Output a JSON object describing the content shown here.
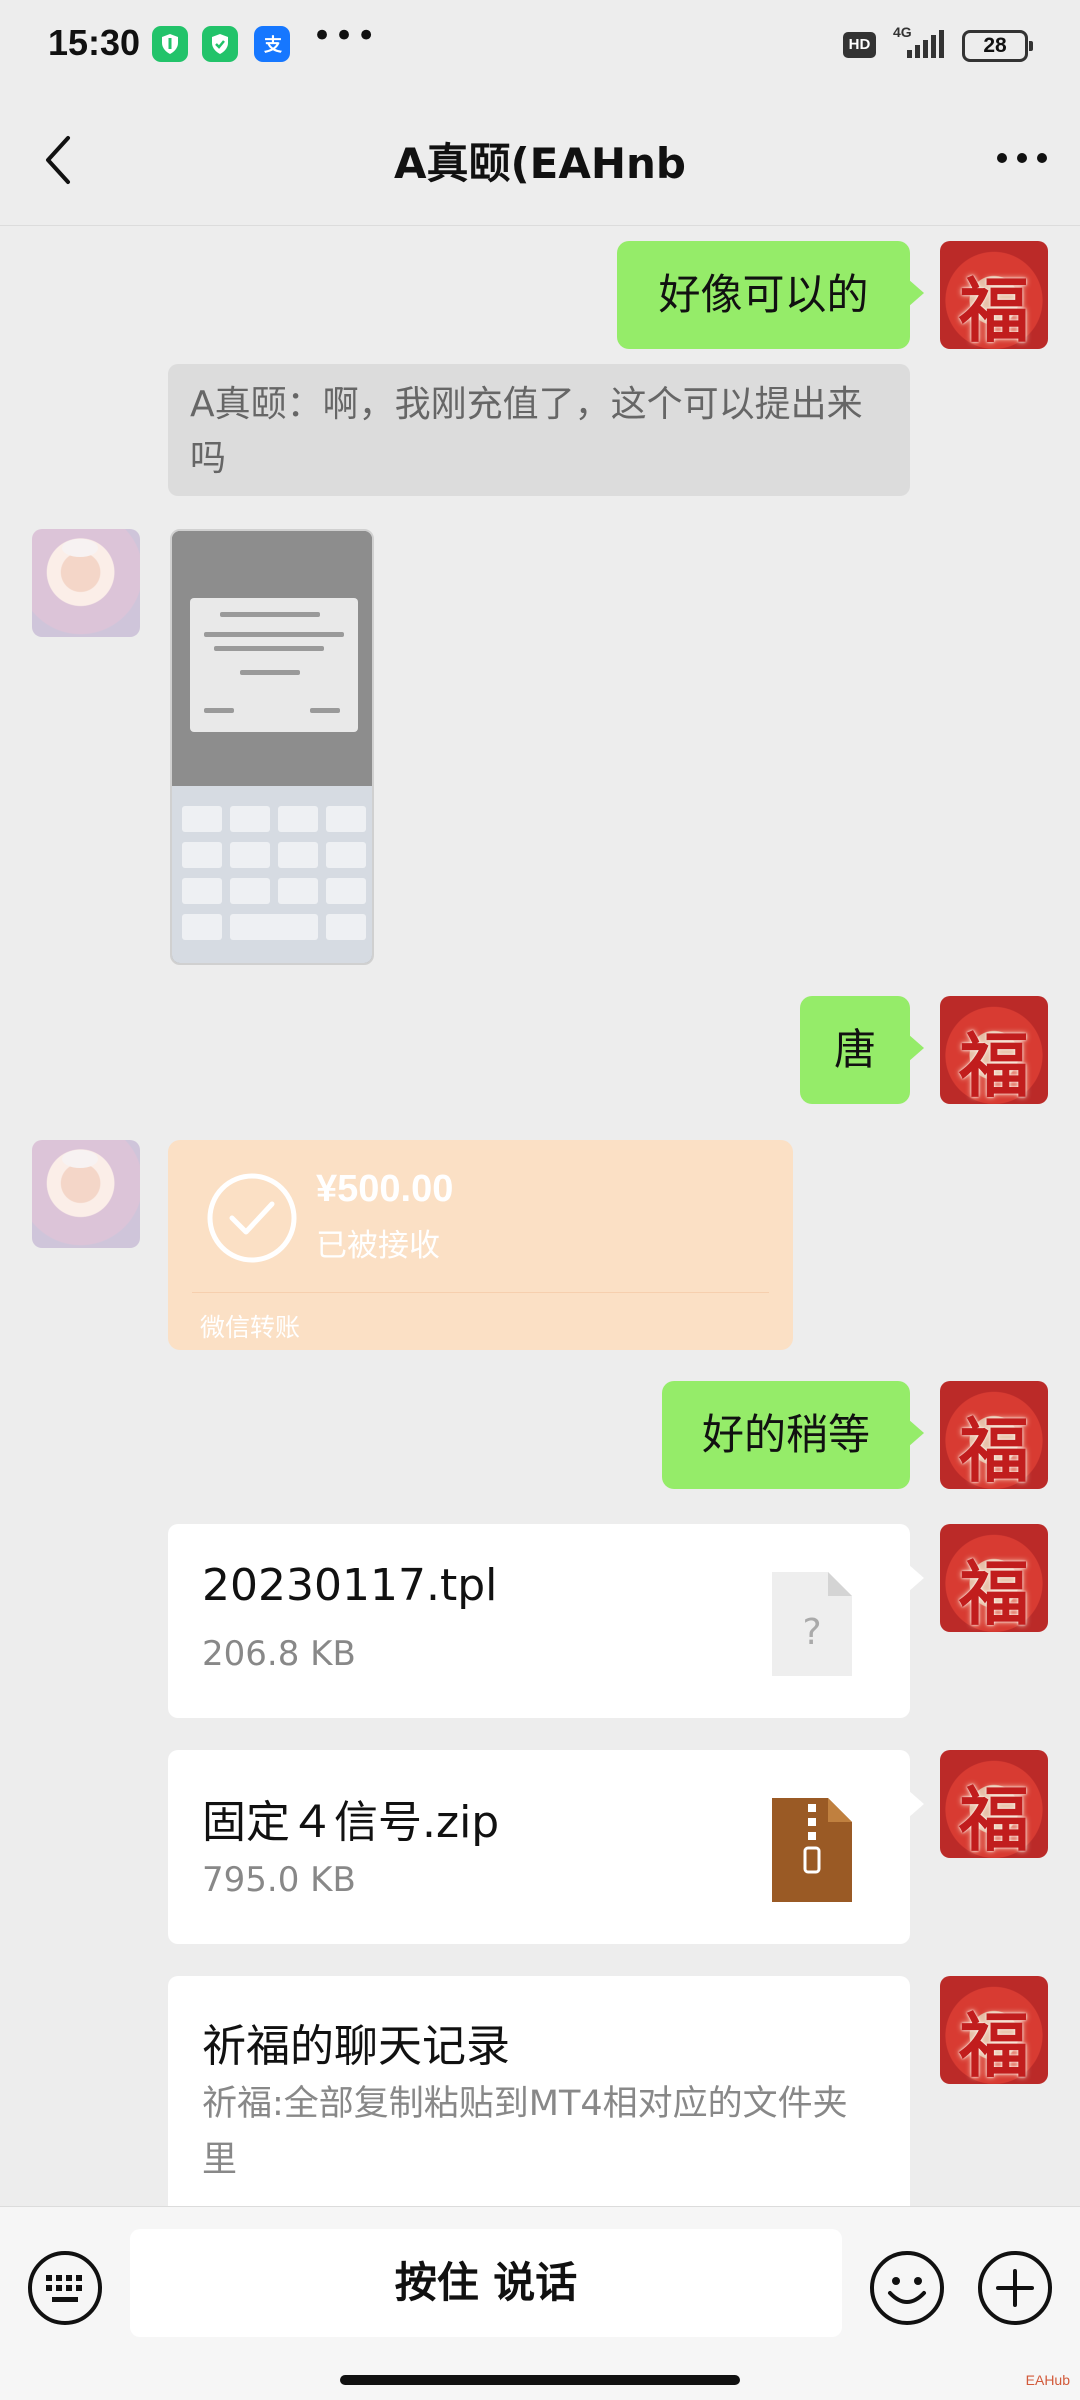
{
  "status_bar": {
    "time": "15:30",
    "more": "•••",
    "hd_badge": "HD",
    "network": "4G",
    "battery": "28"
  },
  "header": {
    "title": "A真颐(EAHnb"
  },
  "messages": {
    "m1_text": "好像可以的",
    "quote_text": "A真颐：啊，我刚充值了，这个可以提出来吗",
    "m3_text": "唐",
    "transfer": {
      "amount": "¥500.00",
      "status": "已被接收",
      "label": "微信转账"
    },
    "m5_text": "好的稍等",
    "file1": {
      "name": "20230117.tpl",
      "size": "206.8 KB"
    },
    "file2": {
      "name": "固定４信号.zip",
      "size": "795.0 KB"
    },
    "record": {
      "title": "祈福的聊天记录",
      "preview": "祈福:全部复制粘贴到MT4相对应的文件夹里"
    }
  },
  "input_bar": {
    "hold_to_talk": "按住 说话"
  },
  "icons": {
    "accent_green": "#95ec69",
    "transfer_orange": "#fbe0c5",
    "avatar_self": "fu-character",
    "avatar_other": "baby-photo"
  },
  "watermark": "EAHub"
}
